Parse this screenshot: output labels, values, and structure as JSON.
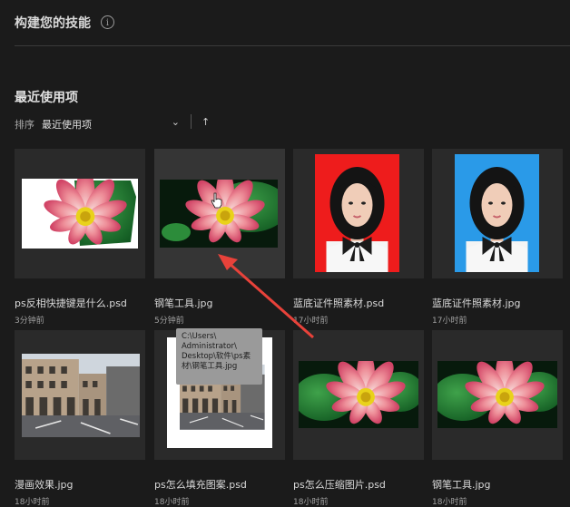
{
  "header": {
    "title": "构建您的技能"
  },
  "recent": {
    "title": "最近使用项",
    "sort_label": "排序",
    "sort_value": "最近使用项"
  },
  "files": [
    {
      "name": "ps反相快捷键是什么.psd",
      "time": "3分钟前"
    },
    {
      "name": "钢笔工具.jpg",
      "time": "5分钟前"
    },
    {
      "name": "蓝底证件照素材.psd",
      "time": "17小时前"
    },
    {
      "name": "蓝底证件照素材.jpg",
      "time": "17小时前"
    },
    {
      "name": "漫画效果.jpg",
      "time": "18小时前"
    },
    {
      "name": "ps怎么填充图案.psd",
      "time": "18小时前"
    },
    {
      "name": "ps怎么压缩图片.psd",
      "time": "18小时前"
    },
    {
      "name": "钢笔工具.jpg",
      "time": "18小时前"
    }
  ],
  "tooltip": {
    "lines": [
      "C:\\Users\\",
      "Administrator\\",
      "Desktop\\软件\\ps素",
      "材\\钢笔工具.jpg"
    ]
  },
  "colors": {
    "accent_arrow": "#e8423a",
    "background": "#1b1b1b"
  }
}
